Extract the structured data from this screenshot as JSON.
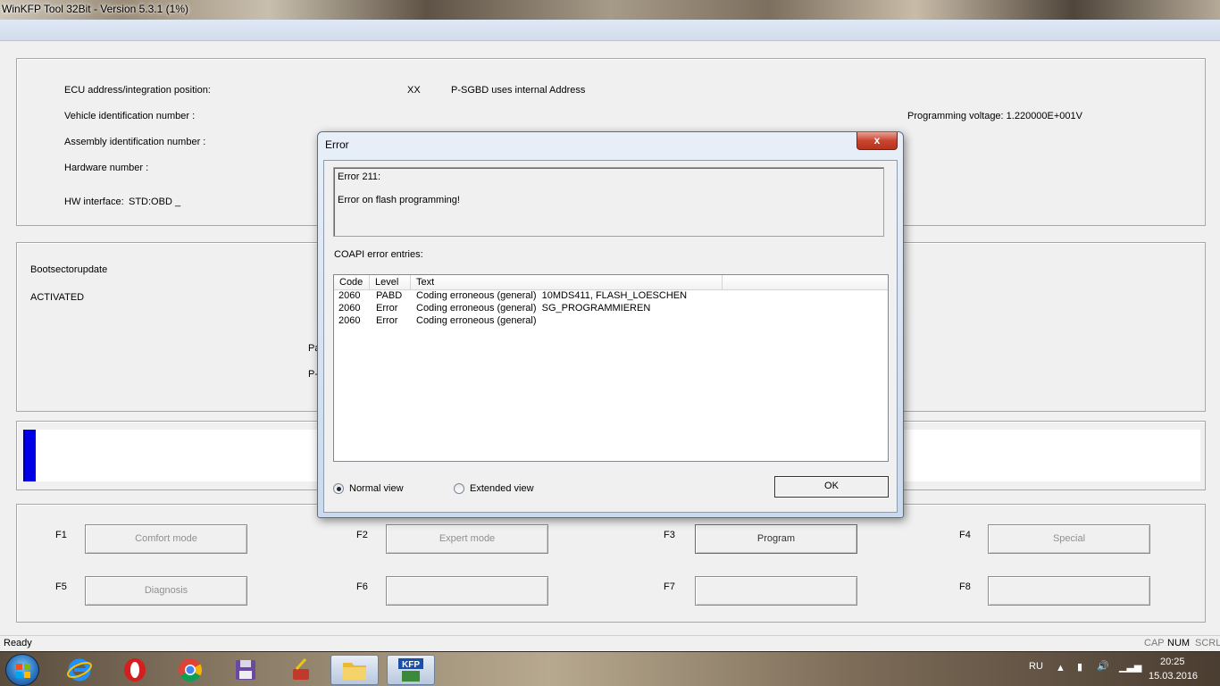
{
  "window": {
    "title": "WinKFP Tool 32Bit - Version 5.3.1 (1%)"
  },
  "info": {
    "ecu_label": "ECU address/integration position:",
    "ecu_value": "XX",
    "psgbd_text": "P-SGBD uses internal Address",
    "vin_label": "Vehicle identification number :",
    "prog_voltage": "Programming voltage: 1.220000E+001V",
    "assembly_label": "Assembly identification number :",
    "hardware_label": "Hardware number :",
    "hw_interface_label": "HW interface:",
    "hw_interface_value": "STD:OBD _"
  },
  "boot": {
    "label": "Bootsectorupdate",
    "status": "ACTIVATED",
    "partial1": "Pa",
    "partial2": "P-"
  },
  "progress": {
    "fraction": 0.01,
    "color": "#0000e6"
  },
  "fkeys": [
    {
      "key": "F1",
      "label": "Comfort mode",
      "enabled": false
    },
    {
      "key": "F2",
      "label": "Expert mode",
      "enabled": false
    },
    {
      "key": "F3",
      "label": "Program",
      "enabled": true
    },
    {
      "key": "F4",
      "label": "Special",
      "enabled": false
    },
    {
      "key": "F5",
      "label": "Diagnosis",
      "enabled": false
    },
    {
      "key": "F6",
      "label": "",
      "enabled": false
    },
    {
      "key": "F7",
      "label": "",
      "enabled": false
    },
    {
      "key": "F8",
      "label": "",
      "enabled": false
    }
  ],
  "status": {
    "text": "Ready",
    "cap": "CAP",
    "num": "NUM",
    "scrl": "SCRL"
  },
  "dialog": {
    "title": "Error",
    "close": "x",
    "error_code": "Error 211:",
    "error_message": "Error on flash programming!",
    "coapi_label": "COAPI error entries:",
    "columns": [
      "Code",
      "Level",
      "Text"
    ],
    "rows": [
      {
        "code": "2060",
        "level": "PABD",
        "text": "Coding erroneous (general)  10MDS411, FLASH_LOESCHEN"
      },
      {
        "code": "2060",
        "level": "Error",
        "text": "Coding erroneous (general)  SG_PROGRAMMIEREN"
      },
      {
        "code": "2060",
        "level": "Error",
        "text": "Coding erroneous (general)"
      }
    ],
    "normal_view": "Normal view",
    "extended_view": "Extended view",
    "selected_view": "normal",
    "ok": "OK"
  },
  "taskbar": {
    "apps": [
      "start-orb-icon",
      "internet-explorer-icon",
      "opera-icon",
      "chrome-icon",
      "save-disk-icon",
      "ccleaner-icon",
      "file-explorer-icon",
      "kfp-icon"
    ],
    "lang": "RU",
    "time": "20:25",
    "date": "15.03.2016"
  }
}
